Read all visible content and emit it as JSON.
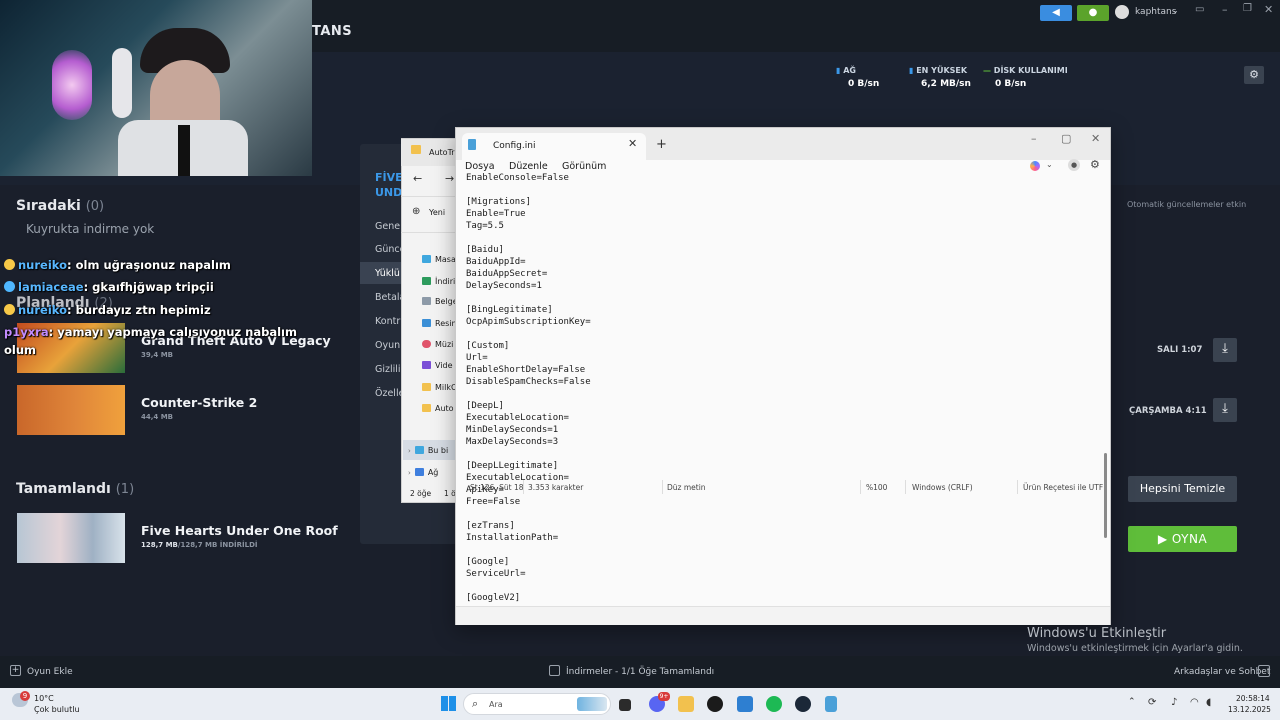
{
  "steam": {
    "brand_fragment": "TANS",
    "username": "kaphtans",
    "stats": [
      {
        "label": "AĞ",
        "value": "0 B/sn"
      },
      {
        "label": "EN YÜKSEK",
        "value": "6,2 MB/sn"
      },
      {
        "label": "DİSK KULLANIMI",
        "value": "0 B/sn"
      }
    ],
    "queue": {
      "title": "Sıradaki",
      "count": "(0)",
      "empty": "Kuyrukta indirme yok"
    },
    "scheduled": {
      "title": "Planlandı",
      "count": "(2)"
    },
    "scheduled_games": [
      {
        "title": "Grand Theft Auto V Legacy",
        "size": "39,4 MB",
        "time": "SALI 1:07"
      },
      {
        "title": "Counter-Strike 2",
        "size": "44,4 MB",
        "time": "ÇARŞAMBA 4:11"
      }
    ],
    "completed": {
      "title": "Tamamlandı",
      "count": "(1)"
    },
    "completed_game": {
      "title": "Five Hearts Under One Roof",
      "size_done": "128,7 MB",
      "size_total": "/128,7 MB İNDİRİLDİ"
    },
    "auto_update": "Otomatik güncellemeler etkin",
    "clear_button": "Hepsini Temizle",
    "play_button": "OYNA",
    "settings_panel": {
      "title_line1": "FİVE",
      "title_line2": "UND",
      "items": [
        "Genel",
        "Günce",
        "Yüklü",
        "Betala",
        "Kontr",
        "Oyun",
        "Gizlili",
        "Özelle"
      ]
    },
    "bottom": {
      "add_game": "Oyun Ekle",
      "downloads": "İndirmeler - 1/1 Öğe Tamamlandı",
      "friends": "Arkadaşlar ve Sohbet"
    }
  },
  "chat": [
    {
      "user": "nureiko",
      "msg": ": olm uğraşıonuz napalım"
    },
    {
      "user": "lamiaceae",
      "msg": ": gkaıfhjğwap tripçii"
    },
    {
      "user": "nureiko",
      "msg": ": burdayız ztn hepimiz"
    },
    {
      "user": "p1yxra",
      "msg": ": yamayı yapmaya calısıyonuz nabalım"
    },
    {
      "user": "",
      "msg": "olum"
    }
  ],
  "explorer": {
    "title": "AutoTr",
    "new": "Yeni",
    "items": [
      "Masa",
      "İndiri",
      "Belge",
      "Resim",
      "Müzi",
      "Vide",
      "MilkC",
      "Auto"
    ],
    "nav": [
      "Bu bi",
      "Ağ"
    ],
    "status_count": "2 öğe",
    "status_sel": "1 ö"
  },
  "notepad": {
    "tab_title": "Config.ini",
    "menu": [
      "Dosya",
      "Düzenle",
      "Görünüm"
    ],
    "content": "EnableConsole=False\n\n[Migrations]\nEnable=True\nTag=5.5\n\n[Baidu]\nBaiduAppId=\nBaiduAppSecret=\nDelaySeconds=1\n\n[BingLegitimate]\nOcpApimSubscriptionKey=\n\n[Custom]\nUrl=\nEnableShortDelay=False\nDisableSpamChecks=False\n\n[DeepL]\nExecutableLocation=\nMinDelaySeconds=1\nMaxDelaySeconds=3\n\n[DeepLLegitimate]\nExecutableLocation=\nApiKey=\nFree=False\n\n[ezTrans]\nInstallationPath=\n\n[Google]\nServiceUrl=\n\n[GoogleV2]",
    "status": {
      "position": "St 126, Süt 18",
      "chars": "3.353 karakter",
      "format": "Düz metin",
      "zoom": "%100",
      "eol": "Windows (CRLF)",
      "encoding": "Ürün Reçetesi ile UTF"
    }
  },
  "windows": {
    "activate_title": "Windows'u Etkinleştir",
    "activate_sub": "Windows'u etkinleştirmek için Ayarlar'a gidin."
  },
  "taskbar": {
    "weather_temp": "10°C",
    "weather_desc": "Çok bulutlu",
    "weather_badge": "9",
    "search": "Ara",
    "discord_badge": "9+",
    "time": "20:58:14",
    "date": "13.12.2025"
  },
  "colors": {
    "steam_green": "#5fbd3a",
    "steam_blue": "#3b98e8",
    "chat_user": "#58b7ff"
  }
}
